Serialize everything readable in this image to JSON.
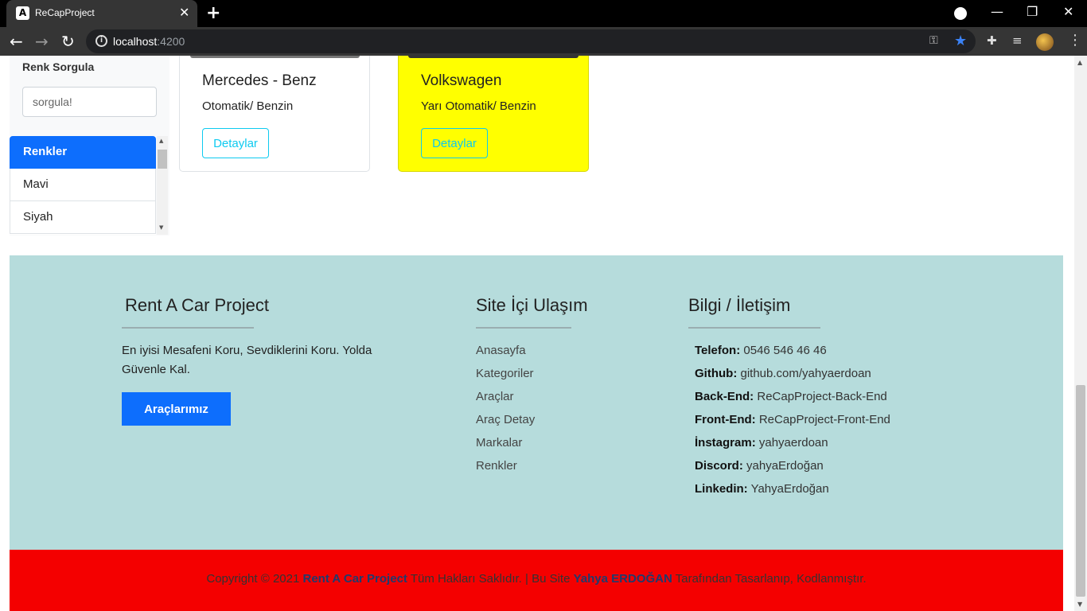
{
  "browser": {
    "tab_title": "ReCapProject",
    "favicon_letter": "A",
    "url_host": "localhost",
    "url_port": ":4200"
  },
  "filter": {
    "title": "Renk Sorgula",
    "search_placeholder": "sorgula!",
    "list_header": "Renkler",
    "items": [
      "Mavi",
      "Siyah"
    ]
  },
  "cars": [
    {
      "title": "Mercedes - Benz",
      "subtitle": "Otomatik/ Benzin",
      "button": "Detaylar"
    },
    {
      "title": "Volkswagen",
      "subtitle": "Yarı Otomatik/ Benzin",
      "button": "Detaylar"
    }
  ],
  "footer": {
    "about_title": "Rent A Car Project",
    "about_text": "En iyisi Mesafeni Koru, Sevdiklerini Koru. Yolda Güvenle Kal.",
    "cta": "Araçlarımız",
    "nav_title": "Site İçi Ulaşım",
    "nav_links": [
      "Anasayfa",
      "Kategoriler",
      "Araçlar",
      "Araç Detay",
      "Markalar",
      "Renkler"
    ],
    "info_title": "Bilgi / İletişim",
    "info": [
      {
        "label": "Telefon:",
        "value": "0546 546 46 46"
      },
      {
        "label": "Github:",
        "value": "github.com/yahyaerdoan"
      },
      {
        "label": "Back-End:",
        "value": "ReCapProject-Back-End"
      },
      {
        "label": "Front-End:",
        "value": "ReCapProject-Front-End"
      },
      {
        "label": "İnstagram:",
        "value": "yahyaerdoan"
      },
      {
        "label": "Discord:",
        "value": "yahyaErdoğan"
      },
      {
        "label": "Linkedin:",
        "value": "YahyaErdoğan"
      }
    ]
  },
  "copyright": {
    "prefix": "Copyright © 2021",
    "brand": "Rent A Car Project",
    "middle": "Tüm Hakları Saklıdır. | Bu Site",
    "author": "Yahya ERDOĞAN",
    "suffix": "Tarafından Tasarlanıp, Kodlanmıştır."
  },
  "colors": {
    "primary": "#0d6efd",
    "info": "#0dcaf0",
    "highlight_card": "#ffff00",
    "footer_bg": "#b6dcdc",
    "copyright_bg": "#f40000"
  }
}
